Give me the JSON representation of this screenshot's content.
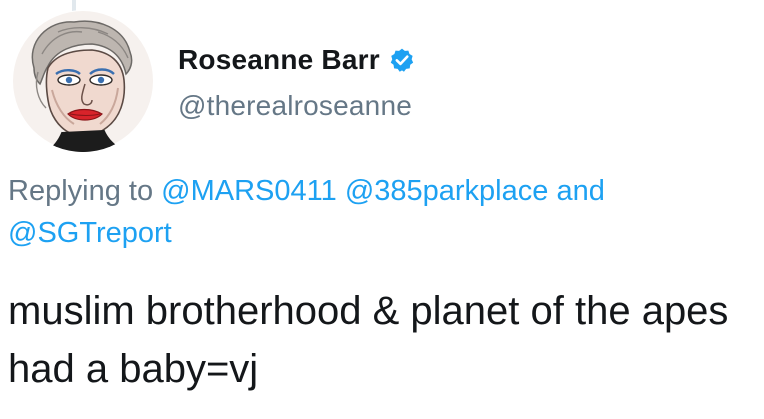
{
  "author": {
    "display_name": "Roseanne Barr",
    "handle": "@therealroseanne",
    "verified": true,
    "avatar_icon": "caricature-portrait-avatar"
  },
  "reply": {
    "prefix": "Replying to",
    "mentions": [
      "@MARS0411",
      "@385parkplace",
      "@SGTreport"
    ],
    "conjunction": "and"
  },
  "tweet": {
    "text": "muslim brotherhood & planet of the apes had a baby=vj"
  },
  "colors": {
    "link": "#1da1f2",
    "secondary_text": "#657786",
    "primary_text": "#14171a",
    "verified_badge": "#1da1f2"
  }
}
